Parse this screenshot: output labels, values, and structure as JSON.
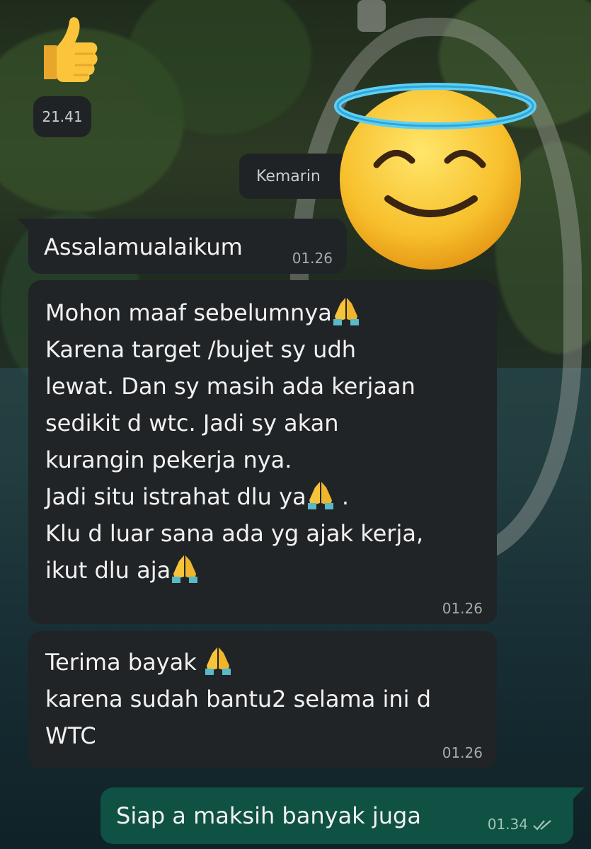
{
  "time_chip": "21.41",
  "date_separator": "Kemarin",
  "messages": [
    {
      "lines": [
        "Assalamualaikum"
      ],
      "time": "01.26"
    },
    {
      "lines": [
        "Mohon maaf sebelumnya",
        "Karena target /bujet sy udh",
        "lewat. Dan sy masih ada kerjaan",
        "sedikit d wtc. Jadi sy akan",
        "kurangin pekerja nya.",
        "Jadi situ istrahat dlu ya",
        " .",
        "Klu d luar sana ada yg ajak kerja,",
        "ikut dlu aja"
      ],
      "time": "01.26"
    },
    {
      "lines": [
        "Terima bayak ",
        "karena sudah bantu2 selama ini d",
        "WTC"
      ],
      "time": "01.26"
    },
    {
      "lines": [
        "Siap a maksih banyak juga"
      ],
      "time": "01.34"
    }
  ],
  "icons": [
    "thumbs-up-emoji",
    "smiling-face-with-halo-emoji",
    "folded-hands-emoji",
    "double-check-icon"
  ],
  "colors": {
    "incoming_bubble": "#202427",
    "outgoing_bubble": "#0f5142",
    "text": "#f1f1f1",
    "meta": "#a6abae"
  }
}
